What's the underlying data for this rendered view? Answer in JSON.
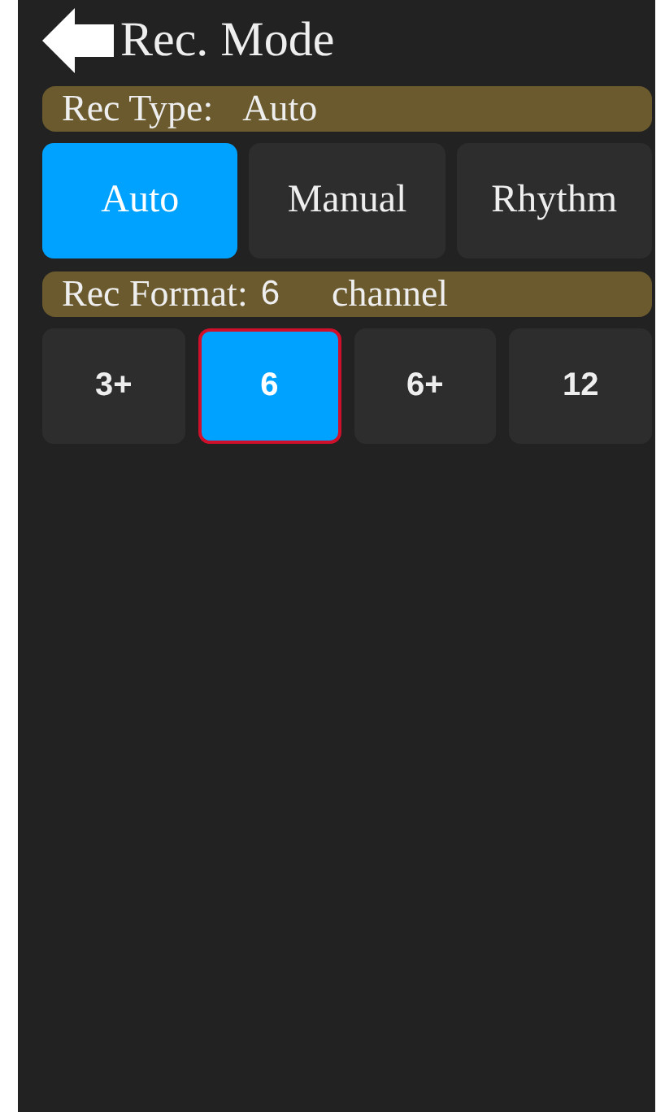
{
  "header": {
    "title": "Rec. Mode"
  },
  "rec_type": {
    "label": "Rec Type:",
    "value": "Auto",
    "options": [
      {
        "label": "Auto",
        "selected": true
      },
      {
        "label": "Manual",
        "selected": false
      },
      {
        "label": "Rhythm",
        "selected": false
      }
    ]
  },
  "rec_format": {
    "label": "Rec Format:",
    "value": "6",
    "unit": "channel",
    "options": [
      {
        "label": "3+",
        "selected": false
      },
      {
        "label": "6",
        "selected": true
      },
      {
        "label": "6+",
        "selected": false
      },
      {
        "label": "12",
        "selected": false
      }
    ]
  }
}
